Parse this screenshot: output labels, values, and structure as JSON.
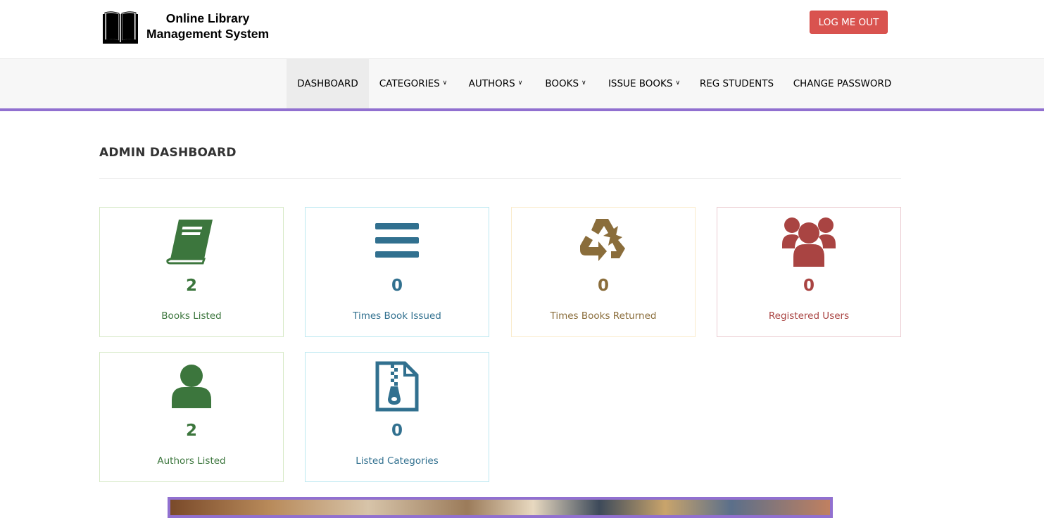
{
  "header": {
    "brand_line1": "Online Library",
    "brand_line2": "Management System",
    "logout_label": "LOG ME OUT"
  },
  "nav": {
    "items": [
      {
        "label": "DASHBOARD",
        "active": true
      },
      {
        "label": "CATEGORIES",
        "dropdown": true
      },
      {
        "label": "AUTHORS",
        "dropdown": true
      },
      {
        "label": "BOOKS",
        "dropdown": true
      },
      {
        "label": "ISSUE BOOKS",
        "dropdown": true
      },
      {
        "label": "REG STUDENTS"
      },
      {
        "label": "CHANGE PASSWORD"
      }
    ],
    "accent_color": "#9170d0"
  },
  "page": {
    "title": "ADMIN DASHBOARD"
  },
  "cards": [
    {
      "count": "2",
      "label": "Books Listed",
      "icon": "book-icon",
      "style": "success"
    },
    {
      "count": "0",
      "label": "Times Book Issued",
      "icon": "bars-icon",
      "style": "info"
    },
    {
      "count": "0",
      "label": "Times Books Returned",
      "icon": "recycle-icon",
      "style": "warning"
    },
    {
      "count": "0",
      "label": "Registered Users",
      "icon": "users-icon",
      "style": "danger"
    },
    {
      "count": "2",
      "label": "Authors Listed",
      "icon": "user-icon",
      "style": "success"
    },
    {
      "count": "0",
      "label": "Listed Categories",
      "icon": "file-archive-icon",
      "style": "info"
    }
  ],
  "colors": {
    "success": "#3c763d",
    "info": "#31708f",
    "warning": "#8a6d3b",
    "danger": "#a94442",
    "logout": "#d9534f"
  }
}
